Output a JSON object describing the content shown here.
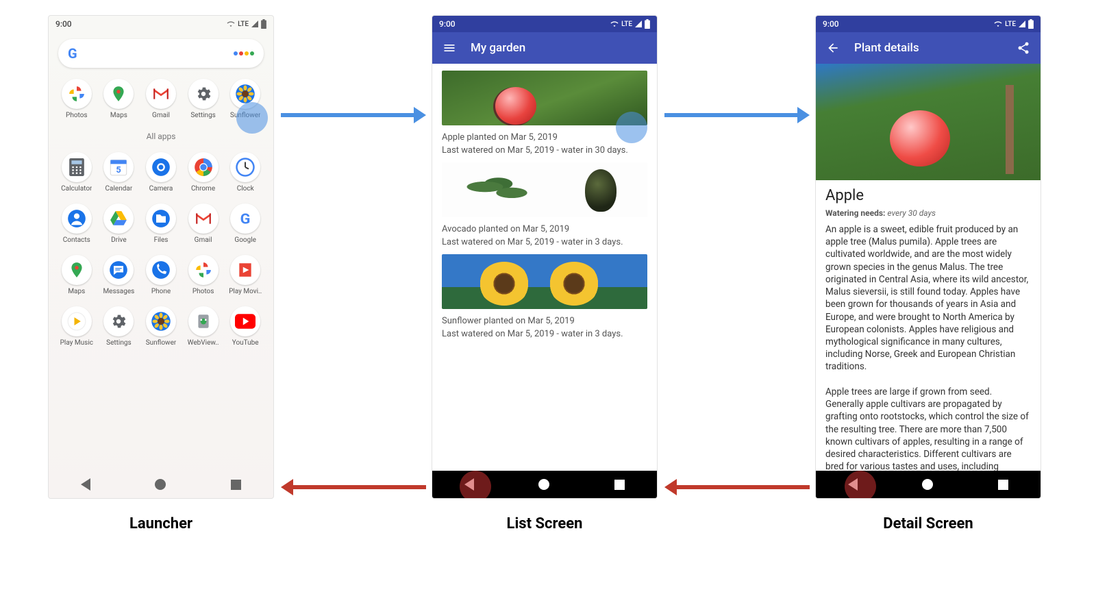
{
  "status": {
    "time": "9:00",
    "network": "LTE"
  },
  "launcher": {
    "all_apps_label": "All apps",
    "dock": [
      {
        "label": "Photos",
        "name": "photos"
      },
      {
        "label": "Maps",
        "name": "maps"
      },
      {
        "label": "Gmail",
        "name": "gmail"
      },
      {
        "label": "Settings",
        "name": "settings"
      },
      {
        "label": "Sunflower",
        "name": "sunflower"
      }
    ],
    "apps": [
      {
        "label": "Calculator",
        "name": "calculator"
      },
      {
        "label": "Calendar",
        "name": "calendar",
        "day": "5"
      },
      {
        "label": "Camera",
        "name": "camera"
      },
      {
        "label": "Chrome",
        "name": "chrome"
      },
      {
        "label": "Clock",
        "name": "clock"
      },
      {
        "label": "Contacts",
        "name": "contacts"
      },
      {
        "label": "Drive",
        "name": "drive"
      },
      {
        "label": "Files",
        "name": "files"
      },
      {
        "label": "Gmail",
        "name": "gmail2"
      },
      {
        "label": "Google",
        "name": "google"
      },
      {
        "label": "Maps",
        "name": "maps2"
      },
      {
        "label": "Messages",
        "name": "messages"
      },
      {
        "label": "Phone",
        "name": "phone"
      },
      {
        "label": "Photos",
        "name": "photos2"
      },
      {
        "label": "Play Movi..",
        "name": "playmovies"
      },
      {
        "label": "Play Music",
        "name": "playmusic"
      },
      {
        "label": "Settings",
        "name": "settings2"
      },
      {
        "label": "Sunflower",
        "name": "sunflower2"
      },
      {
        "label": "WebView..",
        "name": "webview"
      },
      {
        "label": "YouTube",
        "name": "youtube"
      }
    ]
  },
  "list": {
    "title": "My garden",
    "items": [
      {
        "name": "apple",
        "img": "apple-img",
        "line1": "Apple planted on Mar 5, 2019",
        "line2": "Last watered on Mar 5, 2019 - water in 30 days."
      },
      {
        "name": "avocado",
        "img": "avocado-img",
        "line1": "Avocado planted on Mar 5, 2019",
        "line2": "Last watered on Mar 5, 2019 - water in 3 days."
      },
      {
        "name": "sunflower",
        "img": "sunflower-img",
        "line1": "Sunflower planted on Mar 5, 2019",
        "line2": "Last watered on Mar 5, 2019 - water in 3 days."
      }
    ]
  },
  "detail": {
    "title": "Plant details",
    "heading": "Apple",
    "watering_label": "Watering needs:",
    "watering_value": "every 30 days",
    "description": "An apple is a sweet, edible fruit produced by an apple tree (Malus pumila). Apple trees are cultivated worldwide, and are the most widely grown species in the genus Malus. The tree originated in Central Asia, where its wild ancestor, Malus sieversii, is still found today. Apples have been grown for thousands of years in Asia and Europe, and were brought to North America by European colonists. Apples have religious and mythological significance in many cultures, including Norse, Greek and European Christian traditions.\n\nApple trees are large if grown from seed. Generally apple cultivars are propagated by grafting onto rootstocks, which control the size of the resulting tree. There are more than 7,500 known cultivars of apples, resulting in a range of desired characteristics. Different cultivars are bred for various tastes and uses, including cooking, eating raw and cider production. Trees and fruit"
  },
  "captions": {
    "launcher": "Launcher",
    "list": "List Screen",
    "detail": "Detail Screen"
  },
  "icon_colors": {
    "photos": "#000",
    "maps": "#34A853",
    "gmail": "#EA4335",
    "settings": "#5f6368",
    "sunflower": "#f4c430",
    "calculator": "#5f6368",
    "calendar": "#4285F4",
    "camera": "#1a73e8",
    "chrome": "#000",
    "clock": "#4285F4",
    "contacts": "#1a73e8",
    "drive": "#FBBC05",
    "files": "#1a73e8",
    "gmail2": "#EA4335",
    "google": "#4285F4",
    "maps2": "#34A853",
    "messages": "#1a73e8",
    "phone": "#1a73e8",
    "photos2": "#000",
    "playmovies": "#EA4335",
    "playmusic": "#f4b400",
    "settings2": "#5f6368",
    "sunflower2": "#f4c430",
    "webview": "#34A853",
    "youtube": "#FF0000"
  }
}
